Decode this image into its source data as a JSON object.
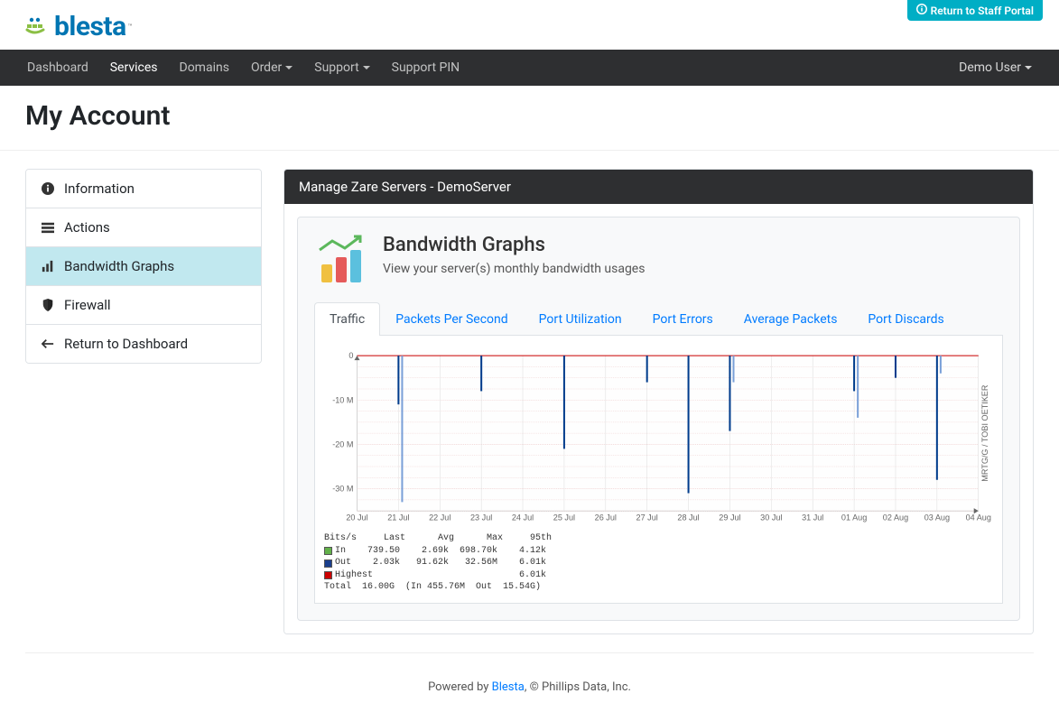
{
  "staff_portal": "Return to Staff Portal",
  "logo_text": "blesta",
  "nav": {
    "items": [
      {
        "label": "Dashboard",
        "active": false,
        "dropdown": false
      },
      {
        "label": "Services",
        "active": true,
        "dropdown": false
      },
      {
        "label": "Domains",
        "active": false,
        "dropdown": false
      },
      {
        "label": "Order",
        "active": false,
        "dropdown": true
      },
      {
        "label": "Support",
        "active": false,
        "dropdown": true
      },
      {
        "label": "Support PIN",
        "active": false,
        "dropdown": false
      }
    ],
    "user": "Demo User"
  },
  "page_title": "My Account",
  "sidebar": {
    "items": [
      {
        "label": "Information",
        "icon": "info",
        "active": false
      },
      {
        "label": "Actions",
        "icon": "list",
        "active": false
      },
      {
        "label": "Bandwidth Graphs",
        "icon": "chart",
        "active": true
      },
      {
        "label": "Firewall",
        "icon": "shield",
        "active": false
      },
      {
        "label": "Return to Dashboard",
        "icon": "arrow-left",
        "active": false
      }
    ]
  },
  "panel": {
    "title": "Manage Zare Servers - DemoServer",
    "card_title": "Bandwidth Graphs",
    "card_sub": "View your server(s) monthly bandwidth usages"
  },
  "tabs": [
    {
      "label": "Traffic",
      "active": true
    },
    {
      "label": "Packets Per Second",
      "active": false
    },
    {
      "label": "Port Utilization",
      "active": false
    },
    {
      "label": "Port Errors",
      "active": false
    },
    {
      "label": "Average Packets",
      "active": false
    },
    {
      "label": "Port Discards",
      "active": false
    }
  ],
  "chart_data": {
    "type": "line",
    "title": "",
    "ylabel_right": "MRTG/G / TOBI OETIKER",
    "ylim": [
      -35000000,
      0
    ],
    "yticks": [
      0,
      -10000000,
      -20000000,
      -30000000
    ],
    "ytick_labels": [
      "0",
      "-10 M",
      "-20 M",
      "-30 M"
    ],
    "x_categories": [
      "20 Jul",
      "21 Jul",
      "22 Jul",
      "23 Jul",
      "24 Jul",
      "25 Jul",
      "26 Jul",
      "27 Jul",
      "28 Jul",
      "29 Jul",
      "30 Jul",
      "31 Jul",
      "01 Aug",
      "02 Aug",
      "03 Aug",
      "04 Aug"
    ],
    "series": [
      {
        "name": "In",
        "color": "#62b14a"
      },
      {
        "name": "Out",
        "color": "#1a3e8c"
      },
      {
        "name": "Highest",
        "color": "#cc0000"
      }
    ],
    "highest_line_y": 0,
    "spikes": [
      {
        "x": "21 Jul",
        "depth": -11000000
      },
      {
        "x": "21 Jul",
        "depth": -33000000,
        "sub": true
      },
      {
        "x": "23 Jul",
        "depth": -8000000
      },
      {
        "x": "25 Jul",
        "depth": -21000000
      },
      {
        "x": "27 Jul",
        "depth": -6000000
      },
      {
        "x": "28 Jul",
        "depth": -31000000
      },
      {
        "x": "29 Jul",
        "depth": -17000000
      },
      {
        "x": "29 Jul",
        "depth": -6000000,
        "sub": true
      },
      {
        "x": "01 Aug",
        "depth": -8000000
      },
      {
        "x": "01 Aug",
        "depth": -14000000,
        "sub": true
      },
      {
        "x": "02 Aug",
        "depth": -5000000
      },
      {
        "x": "03 Aug",
        "depth": -28000000
      },
      {
        "x": "03 Aug",
        "depth": -4000000,
        "sub": true
      }
    ],
    "legend": {
      "header": "Bits/s     Last      Avg      Max     95th",
      "rows": [
        {
          "swatch": "#62b14a",
          "text": "In    739.50    2.69k  698.70k    4.12k"
        },
        {
          "swatch": "#1a3e8c",
          "text": "Out    2.03k   91.62k   32.56M    6.01k"
        },
        {
          "swatch": "#cc0000",
          "text": "Highest                           6.01k"
        }
      ],
      "total": "Total  16.00G  (In 455.76M  Out  15.54G)"
    }
  },
  "footer": {
    "prefix": "Powered by ",
    "link": "Blesta",
    "suffix": ", © Phillips Data, Inc."
  }
}
